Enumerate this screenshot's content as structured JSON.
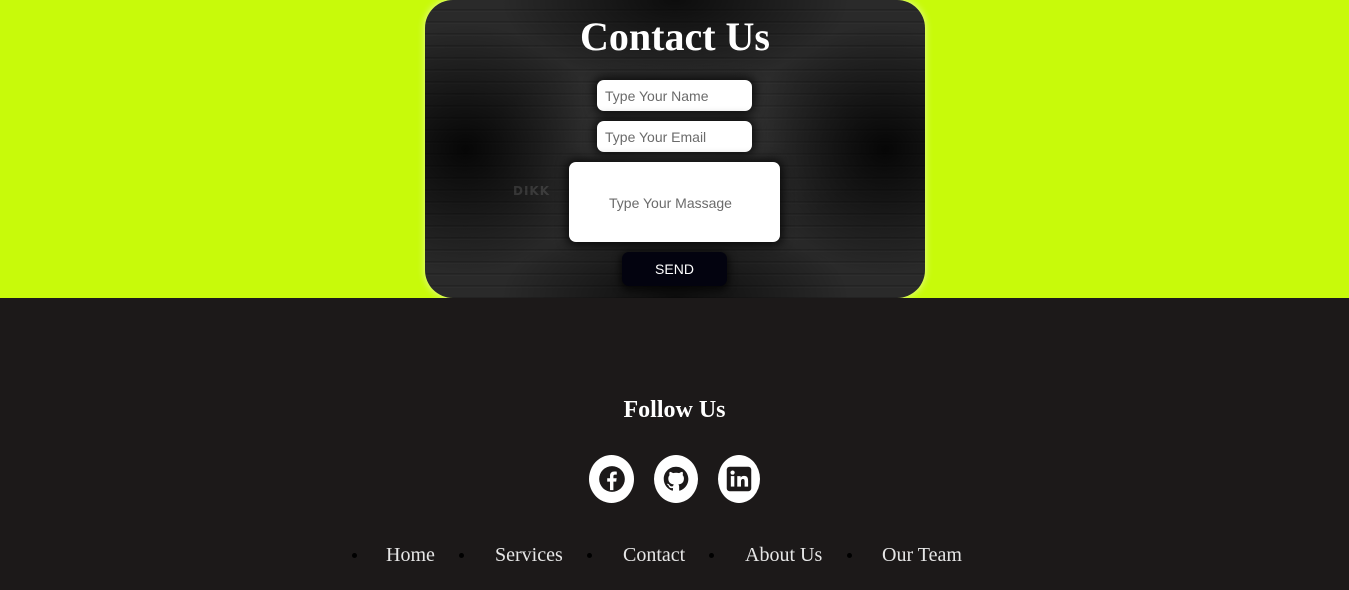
{
  "contact": {
    "title": "Contact Us",
    "watermark": "DIKK",
    "name_placeholder": "Type Your Name",
    "email_placeholder": "Type Your Email",
    "message_placeholder": "Type Your Massage",
    "send_label": "SEND"
  },
  "footer": {
    "title": "Follow Us",
    "social": [
      {
        "name": "facebook-icon"
      },
      {
        "name": "github-icon"
      },
      {
        "name": "linkedin-icon"
      }
    ],
    "nav": [
      {
        "label": "Home"
      },
      {
        "label": "Services"
      },
      {
        "label": "Contact"
      },
      {
        "label": "About Us"
      },
      {
        "label": "Our Team"
      }
    ]
  },
  "colors": {
    "accent": "#c8fa0a",
    "footer_bg": "#1c1919",
    "button_bg": "#03030f"
  }
}
